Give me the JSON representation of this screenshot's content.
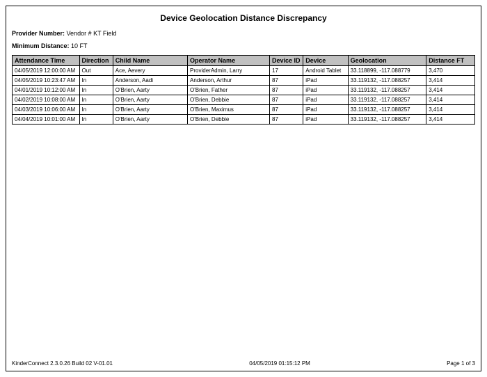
{
  "title": "Device Geolocation Distance Discrepancy",
  "provider": {
    "label": "Provider Number:",
    "value": "Vendor # KT Field"
  },
  "min_distance": {
    "label": "Minimum Distance:",
    "value": "10 FT"
  },
  "columns": {
    "time": "Attendance Time",
    "direction": "Direction",
    "child": "Child Name",
    "operator": "Operator Name",
    "device_id": "Device ID",
    "device": "Device",
    "geo": "Geolocation",
    "distance": "Distance FT"
  },
  "rows": [
    {
      "time": "04/05/2019 12:00:00 AM",
      "direction": "Out",
      "child": "Ace, Aevery",
      "operator": "ProviderAdmin, Larry",
      "device_id": "17",
      "device": "Android Tablet",
      "geo": "33.118899, -117.088779",
      "distance": "3,470"
    },
    {
      "time": "04/05/2019 10:23:47 AM",
      "direction": "In",
      "child": "Anderson, Aadi",
      "operator": "Anderson, Arthur",
      "device_id": "87",
      "device": "iPad",
      "geo": "33.119132, -117.088257",
      "distance": "3,414"
    },
    {
      "time": "04/01/2019 10:12:00 AM",
      "direction": "In",
      "child": "O'Brien, Aarty",
      "operator": "O'Brien, Father",
      "device_id": "87",
      "device": "iPad",
      "geo": "33.119132, -117.088257",
      "distance": "3,414"
    },
    {
      "time": "04/02/2019 10:08:00 AM",
      "direction": "In",
      "child": "O'Brien, Aarty",
      "operator": "O'Brien, Debbie",
      "device_id": "87",
      "device": "iPad",
      "geo": "33.119132, -117.088257",
      "distance": "3,414"
    },
    {
      "time": "04/03/2019 10:06:00 AM",
      "direction": "In",
      "child": "O'Brien, Aarty",
      "operator": "O'Brien, Maximus",
      "device_id": "87",
      "device": "iPad",
      "geo": "33.119132, -117.088257",
      "distance": "3,414"
    },
    {
      "time": "04/04/2019 10:01:00 AM",
      "direction": "In",
      "child": "O'Brien, Aarty",
      "operator": "O'Brien, Debbie",
      "device_id": "87",
      "device": "iPad",
      "geo": "33.119132, -117.088257",
      "distance": "3,414"
    }
  ],
  "footer": {
    "version": "KinderConnect 2.3.0.26 Build 02 V-01.01",
    "timestamp": "04/05/2019 01:15:12 PM",
    "page": "Page 1 of 3"
  }
}
